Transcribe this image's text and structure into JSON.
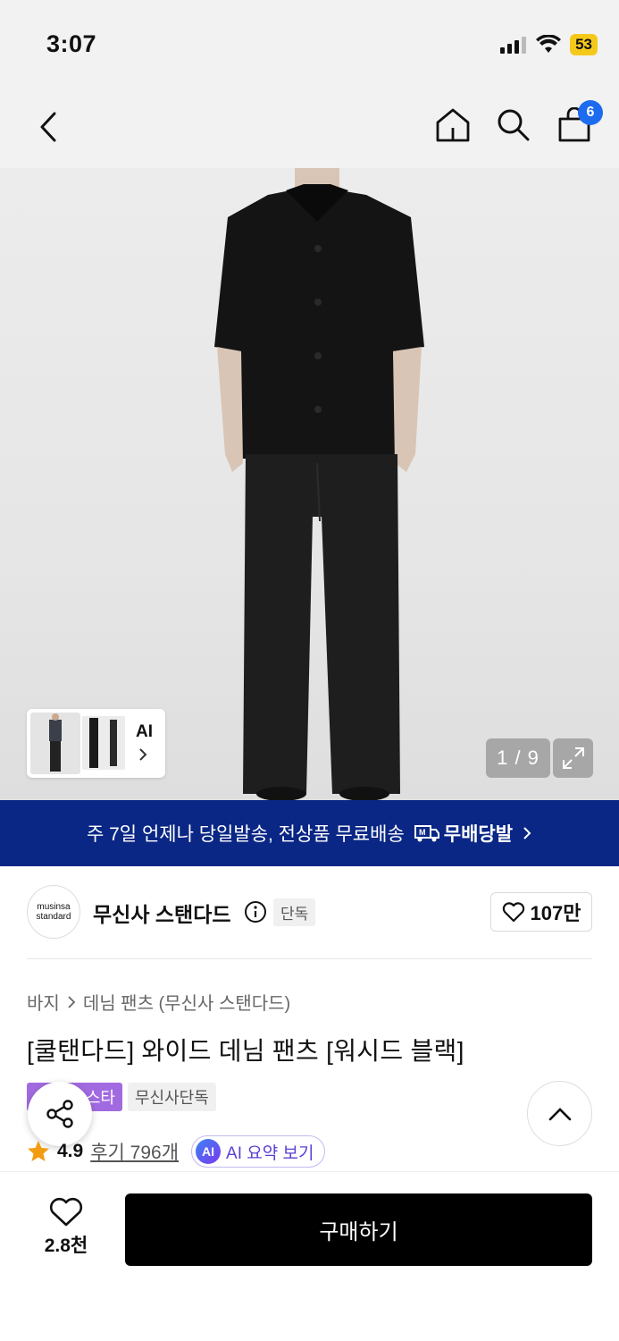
{
  "status_bar": {
    "time": "3:07",
    "battery": "53"
  },
  "nav": {
    "cart_count": "6",
    "icons": [
      "back-icon",
      "home-icon",
      "search-icon",
      "cart-icon"
    ]
  },
  "gallery": {
    "ai_label": "AI",
    "counter": "1 / 9"
  },
  "banner": {
    "text": "주 7일 언제나 당일발송, 전상품 무료배송",
    "badge": "무배당발",
    "brand_color": "#0a2785"
  },
  "brand": {
    "logo_line1": "musinsa",
    "logo_line2": "standard",
    "name": "무신사 스탠다드",
    "tag": "단독",
    "likes": "107만"
  },
  "product": {
    "breadcrumb": [
      "바지",
      "데님 팬츠 (무신사 스탠다드)"
    ],
    "title": "[쿨탠다드] 와이드 데님 팬츠 [워시드 블랙]",
    "tags": [
      "스타",
      "무신사단독"
    ],
    "rating": "4.9",
    "reviews": "후기 796개",
    "ai_summary": "AI 요약 보기",
    "ai_badge": "AI"
  },
  "bottom": {
    "wish_count": "2.8천",
    "buy_label": "구매하기"
  }
}
